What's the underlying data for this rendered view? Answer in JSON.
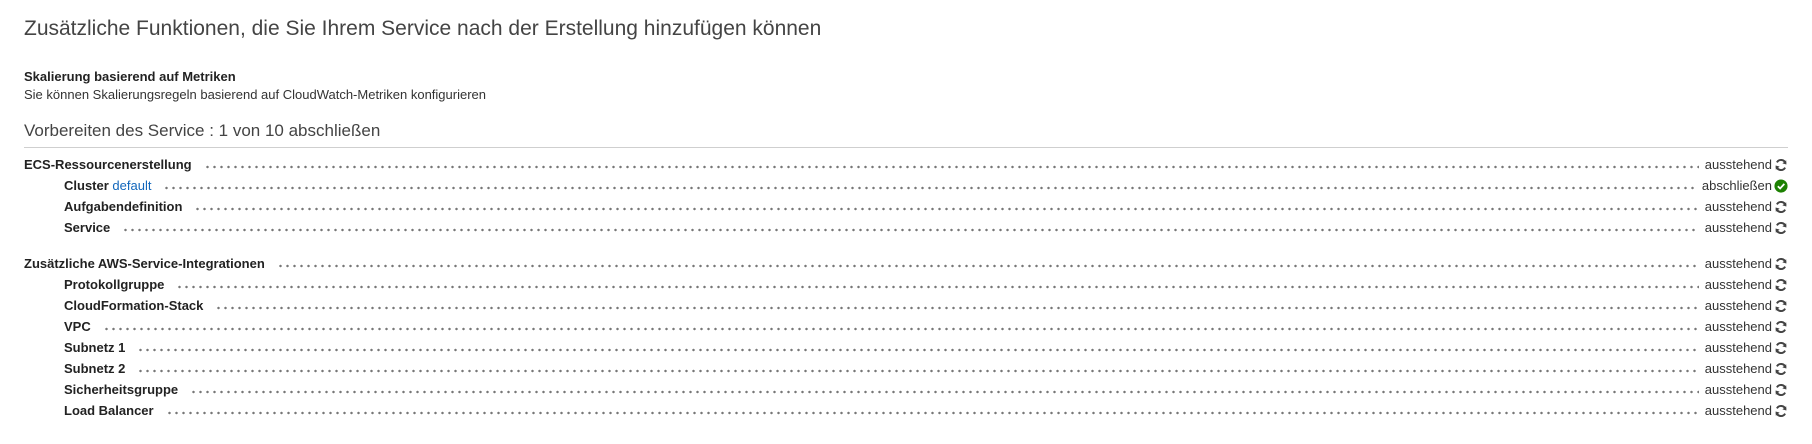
{
  "page_title": "Zusätzliche Funktionen, die Sie Ihrem Service nach der Erstellung hinzufügen können",
  "feature": {
    "title": "Skalierung basierend auf Metriken",
    "description": "Sie können Skalierungsregeln basierend auf CloudWatch-Metriken konfigurieren"
  },
  "progress": {
    "title": "Vorbereiten des Service : 1 von 10 abschließen",
    "completed": 1,
    "total": 10
  },
  "groups": [
    {
      "label": "ECS-Ressourcenerstellung",
      "status": "ausstehend",
      "items": [
        {
          "label": "Cluster",
          "link": "default",
          "status": "abschließen"
        },
        {
          "label": "Aufgabendefinition",
          "status": "ausstehend"
        },
        {
          "label": "Service",
          "status": "ausstehend"
        }
      ]
    },
    {
      "label": "Zusätzliche AWS-Service-Integrationen",
      "status": "ausstehend",
      "items": [
        {
          "label": "Protokollgruppe",
          "status": "ausstehend"
        },
        {
          "label": "CloudFormation-Stack",
          "status": "ausstehend"
        },
        {
          "label": "VPC",
          "status": "ausstehend"
        },
        {
          "label": "Subnetz 1",
          "status": "ausstehend"
        },
        {
          "label": "Subnetz 2",
          "status": "ausstehend"
        },
        {
          "label": "Sicherheitsgruppe",
          "status": "ausstehend"
        },
        {
          "label": "Load Balancer",
          "status": "ausstehend"
        }
      ]
    }
  ],
  "icons": {
    "pending": "refresh-icon",
    "complete": "check-circle-icon"
  },
  "colors": {
    "link": "#1166bb",
    "complete": "#1d8102",
    "pending_icon": "#444444"
  }
}
